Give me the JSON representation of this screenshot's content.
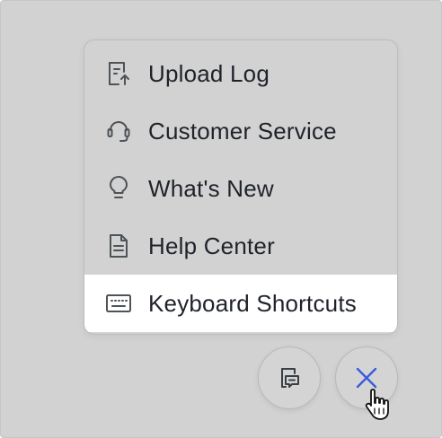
{
  "menu": {
    "items": [
      {
        "label": "Upload Log",
        "icon": "upload-log-icon"
      },
      {
        "label": "Customer Service",
        "icon": "headset-icon"
      },
      {
        "label": "What's New",
        "icon": "lightbulb-icon"
      },
      {
        "label": "Help Center",
        "icon": "document-icon"
      },
      {
        "label": "Keyboard Shortcuts",
        "icon": "keyboard-icon",
        "highlighted": true
      }
    ]
  },
  "fabs": {
    "feedback": {
      "icon": "feedback-icon"
    },
    "close": {
      "icon": "close-icon"
    }
  },
  "colors": {
    "backdrop": "#d2d2d2",
    "highlight": "#ffffff",
    "text": "#1f2329",
    "icon": "#4e5358",
    "accent": "#3b5bdb"
  }
}
